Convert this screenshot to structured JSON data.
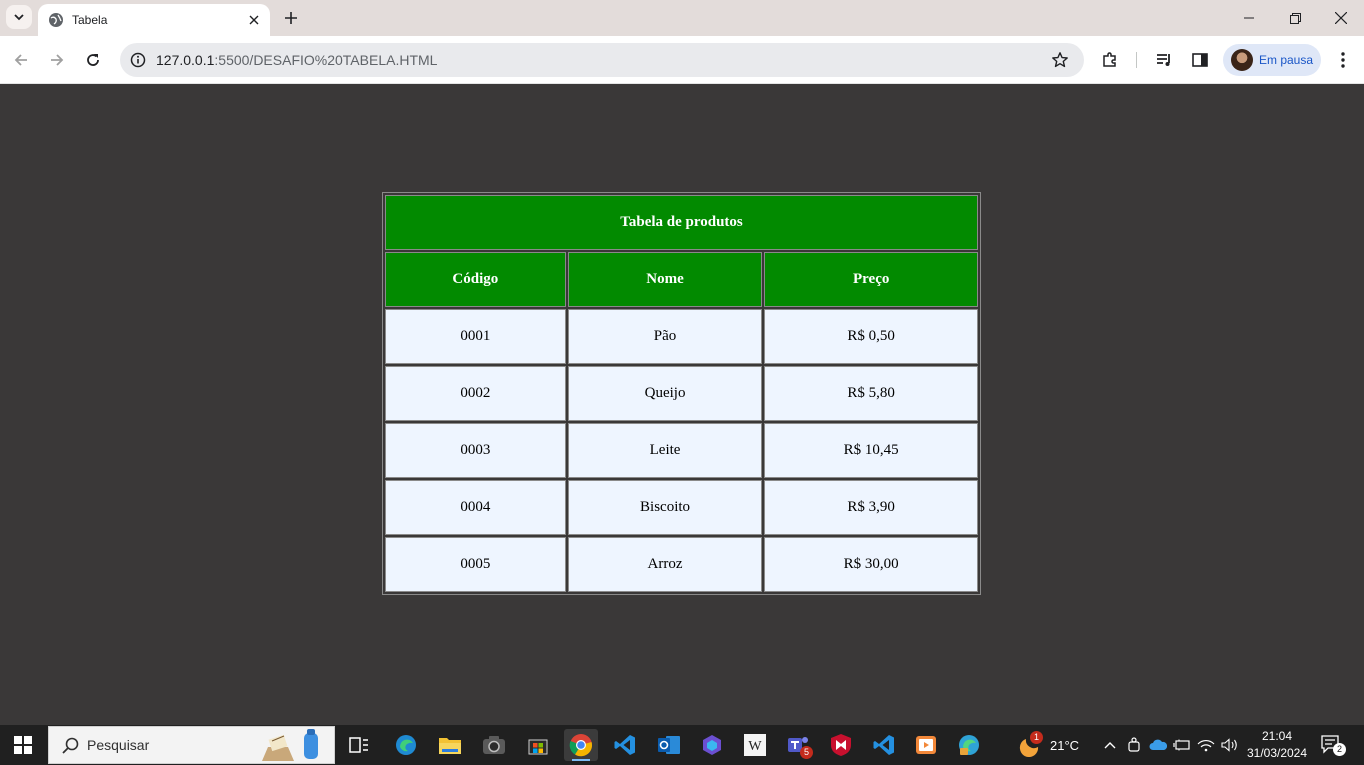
{
  "browser": {
    "tab_title": "Tabela",
    "url_host": "127.0.0.1",
    "url_rest": ":5500/DESAFIO%20TABELA.HTML",
    "profile_label": "Em pausa"
  },
  "table": {
    "caption": "Tabela de produtos",
    "headers": [
      "Código",
      "Nome",
      "Preço"
    ],
    "rows": [
      [
        "0001",
        "Pão",
        "R$ 0,50"
      ],
      [
        "0002",
        "Queijo",
        "R$ 5,80"
      ],
      [
        "0003",
        "Leite",
        "R$ 10,45"
      ],
      [
        "0004",
        "Biscoito",
        "R$ 3,90"
      ],
      [
        "0005",
        "Arroz",
        "R$ 30,00"
      ]
    ]
  },
  "taskbar": {
    "search_placeholder": "Pesquisar",
    "teams_badge": "5",
    "weather_badge": "1",
    "weather_temp": "21°C",
    "time": "21:04",
    "date": "31/03/2024",
    "notification_count": "2"
  },
  "colors": {
    "page_background": "#3a3838",
    "header_green": "#028a00",
    "cell_background": "#eef5ff"
  },
  "icons": [
    "tab-search-icon",
    "globe-icon",
    "close-icon",
    "plus-icon",
    "minimize-icon",
    "restore-icon",
    "back-icon",
    "forward-icon",
    "reload-icon",
    "info-icon",
    "star-icon",
    "extensions-icon",
    "media-icon",
    "sidepanel-icon",
    "kebab-icon",
    "windows-icon",
    "search-icon"
  ]
}
